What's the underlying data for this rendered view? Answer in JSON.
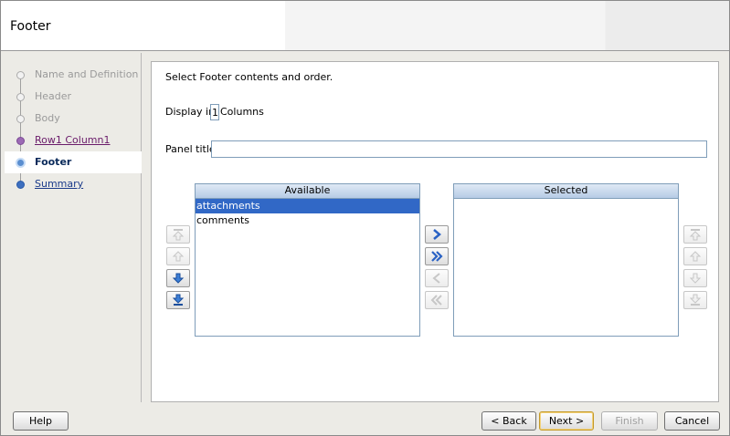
{
  "header": {
    "title": "Footer"
  },
  "nav": {
    "items": [
      {
        "label": "Name and Definition"
      },
      {
        "label": "Header"
      },
      {
        "label": "Body"
      },
      {
        "label": "Row1 Column1"
      },
      {
        "label": "Footer"
      },
      {
        "label": "Summary"
      }
    ]
  },
  "main": {
    "instruction": "Select Footer contents and order.",
    "display_in_label": "Display in",
    "columns_value": "1",
    "columns_label": "Columns",
    "panel_title_label": "Panel title",
    "panel_title_value": "",
    "available": {
      "header": "Available",
      "items": [
        "attachments",
        "comments"
      ],
      "selected_item": "attachments"
    },
    "selected": {
      "header": "Selected",
      "items": []
    }
  },
  "footer": {
    "help": "Help",
    "back": "< Back",
    "next": "Next >",
    "finish": "Finish",
    "cancel": "Cancel"
  }
}
